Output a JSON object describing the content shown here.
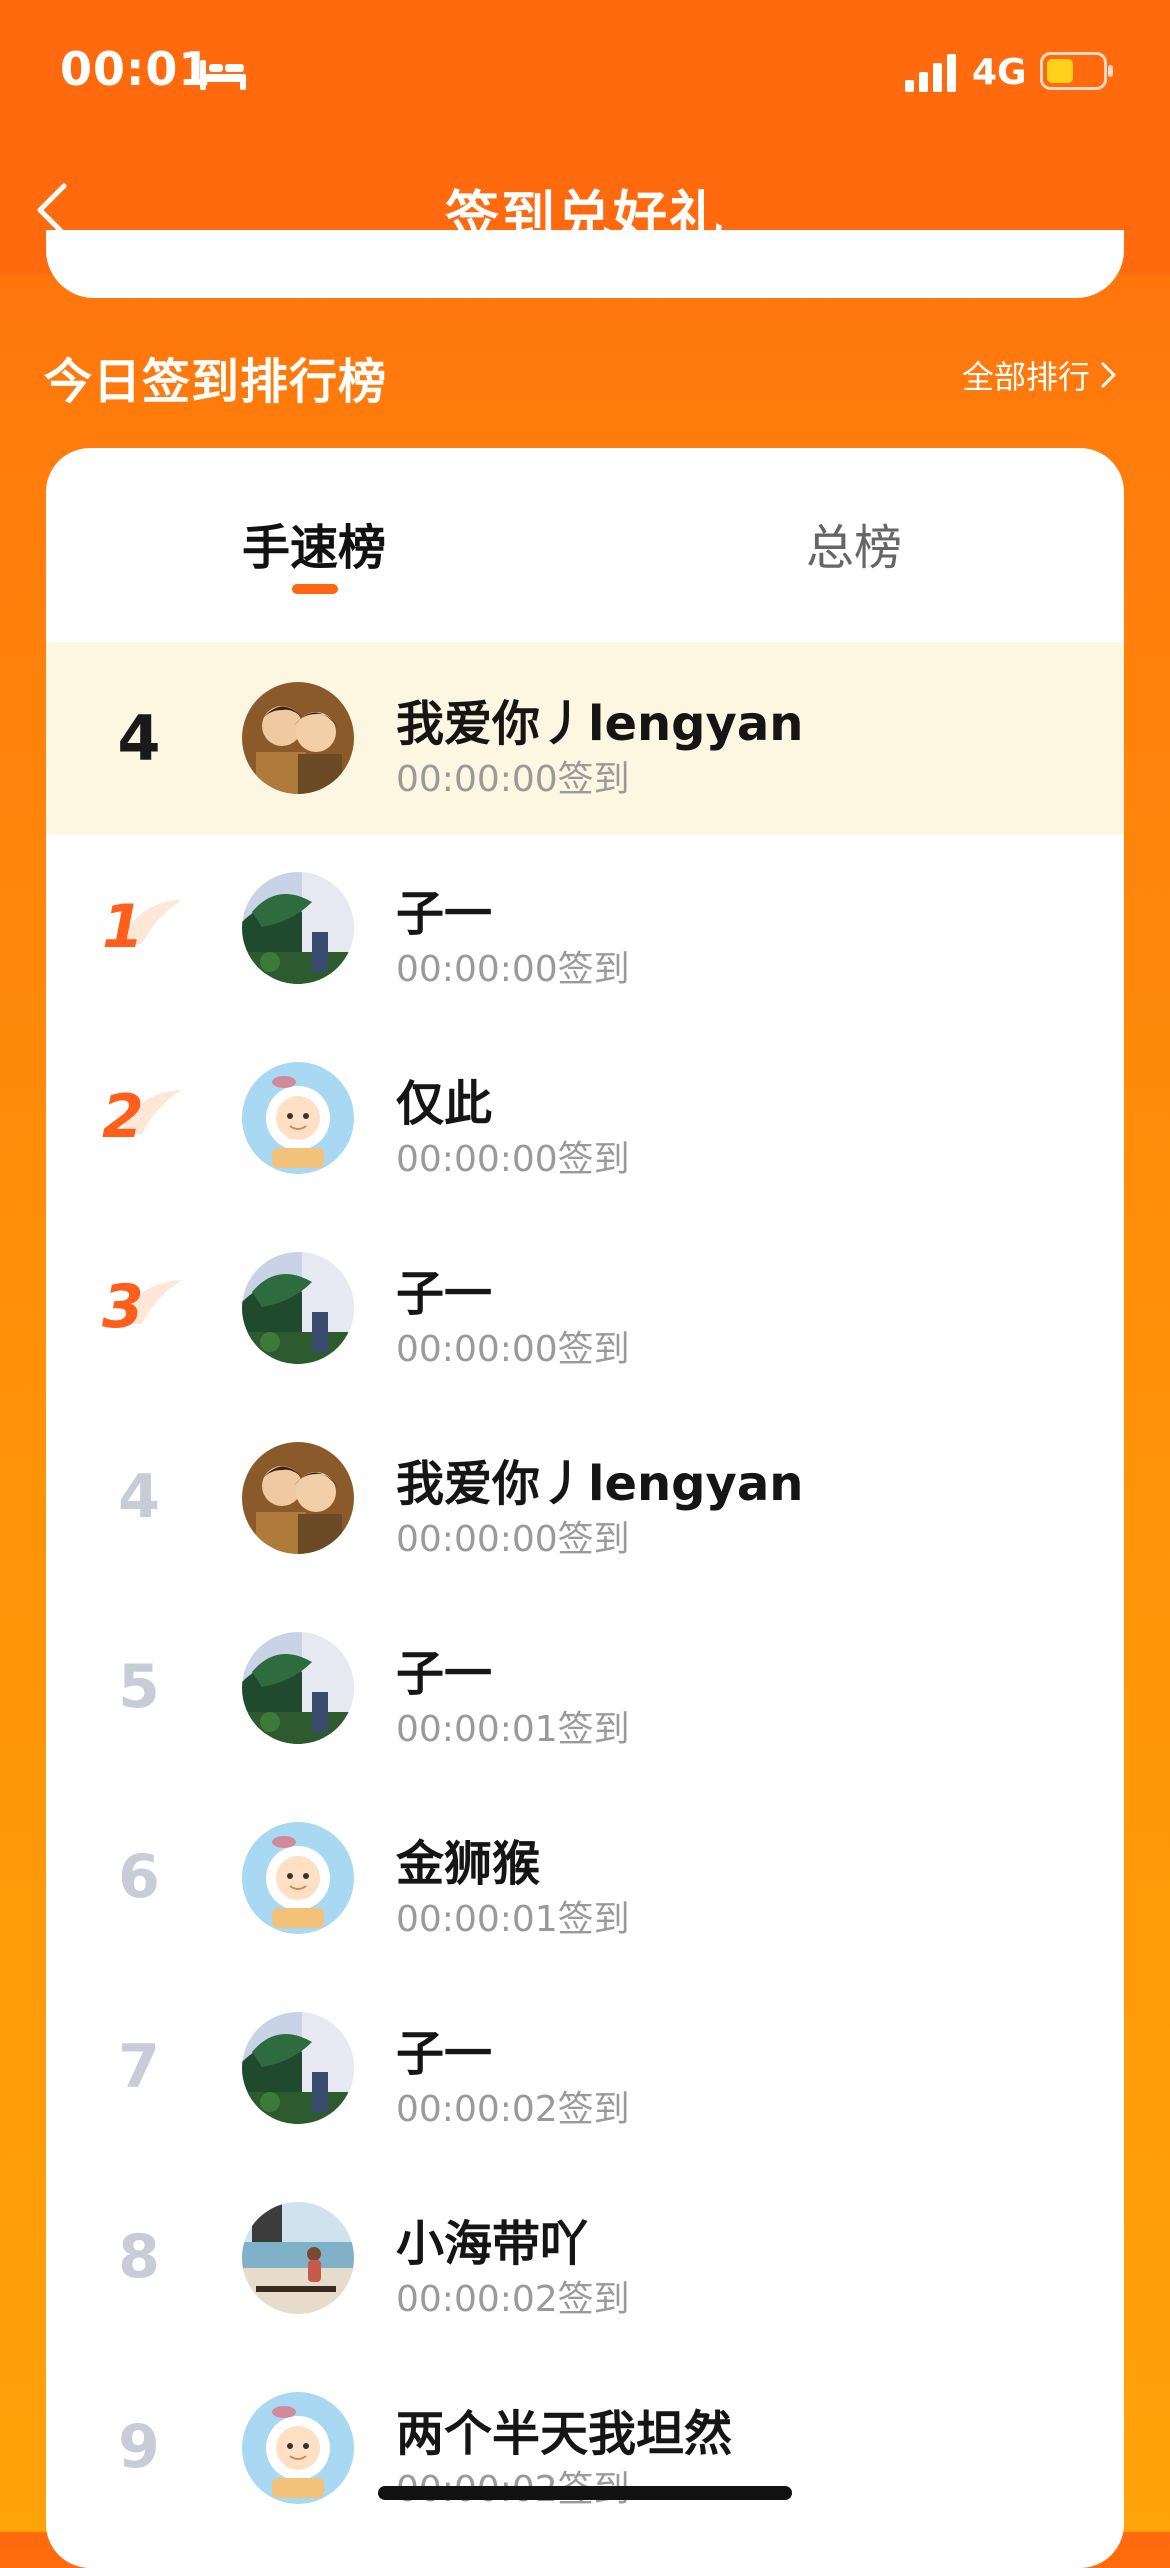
{
  "status_bar": {
    "time": "00:01",
    "network": "4G"
  },
  "nav": {
    "title": "签到兑好礼"
  },
  "section": {
    "title": "今日签到排行榜",
    "all_rank_label": "全部排行"
  },
  "tabs": [
    {
      "label": "手速榜",
      "active": true
    },
    {
      "label": "总榜",
      "active": false
    }
  ],
  "my_row": {
    "rank": "4",
    "name": "我爱你丿lengyan",
    "time": "00:00:00签到",
    "avatar": "anime-avatar"
  },
  "rows": [
    {
      "rank": "1",
      "name": "子一",
      "time": "00:00:00签到",
      "avatar": "landscape-avatar"
    },
    {
      "rank": "2",
      "name": "仅此",
      "time": "00:00:00签到",
      "avatar": "astronaut-avatar"
    },
    {
      "rank": "3",
      "name": "子一",
      "time": "00:00:00签到",
      "avatar": "landscape-avatar"
    },
    {
      "rank": "4",
      "name": "我爱你丿lengyan",
      "time": "00:00:00签到",
      "avatar": "anime-avatar"
    },
    {
      "rank": "5",
      "name": "子一",
      "time": "00:00:01签到",
      "avatar": "landscape-avatar"
    },
    {
      "rank": "6",
      "name": "金狮猴",
      "time": "00:00:01签到",
      "avatar": "astronaut-avatar"
    },
    {
      "rank": "7",
      "name": "子一",
      "time": "00:00:02签到",
      "avatar": "landscape-avatar"
    },
    {
      "rank": "8",
      "name": "小海带吖",
      "time": "00:00:02签到",
      "avatar": "beach-avatar"
    },
    {
      "rank": "9",
      "name": "两个半天我坦然",
      "time": "00:00:02签到",
      "avatar": "astronaut-avatar"
    }
  ],
  "colors": {
    "accent": "#ff6512",
    "highlight_row": "#fdf6e1",
    "rank_grey": "#c7ccd6"
  }
}
